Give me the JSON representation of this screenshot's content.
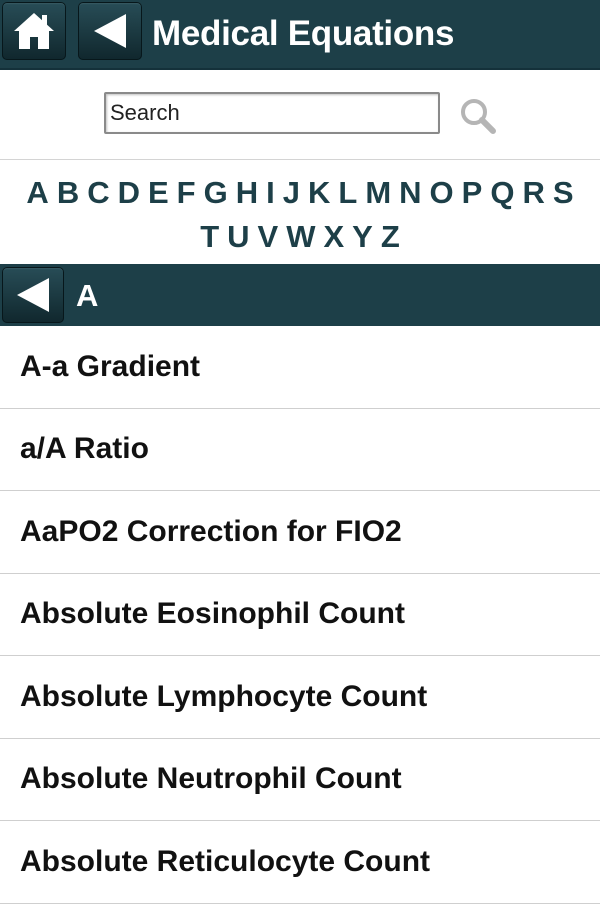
{
  "header": {
    "title": "Medical Equations",
    "home_icon": "home-icon",
    "back_icon": "back-arrow-icon",
    "background": "#1d3f48"
  },
  "search": {
    "placeholder": "Search",
    "value": "",
    "icon": "magnifier-icon"
  },
  "alphabet": {
    "row1": [
      "A",
      "B",
      "C",
      "D",
      "E",
      "F",
      "G",
      "H",
      "I",
      "J",
      "K",
      "L",
      "M",
      "N",
      "O",
      "P",
      "Q",
      "R",
      "S"
    ],
    "row2": [
      "T",
      "U",
      "V",
      "W",
      "X",
      "Y",
      "Z"
    ],
    "color": "#1d3f48"
  },
  "section": {
    "title": "A",
    "back_icon": "back-arrow-icon"
  },
  "list": {
    "items": [
      "A-a Gradient",
      "a/A Ratio",
      "AaPO2 Correction for FIO2",
      "Absolute Eosinophil Count",
      "Absolute Lymphocyte Count",
      "Absolute Neutrophil Count",
      "Absolute Reticulocyte Count"
    ]
  }
}
